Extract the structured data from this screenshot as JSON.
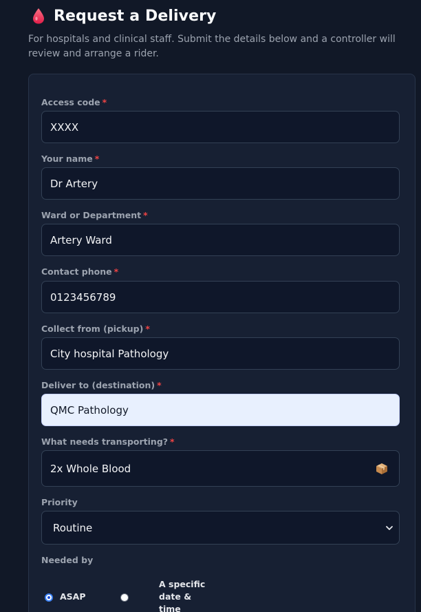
{
  "header": {
    "title": "Request a Delivery",
    "subtitle": "For hospitals and clinical staff. Submit the details below and a controller will review and arrange a rider."
  },
  "form": {
    "required_marker": "*",
    "access_code": {
      "label": "Access code",
      "value": "XXXX"
    },
    "your_name": {
      "label": "Your name",
      "value": "Dr Artery"
    },
    "ward": {
      "label": "Ward or Department",
      "value": "Artery Ward"
    },
    "contact_phone": {
      "label": "Contact phone",
      "value": "0123456789"
    },
    "collect_from": {
      "label": "Collect from (pickup)",
      "value": "City hospital Pathology"
    },
    "deliver_to": {
      "label": "Deliver to (destination)",
      "value": "QMC Pathology"
    },
    "transport_item": {
      "label": "What needs transporting?",
      "value": "2x Whole Blood",
      "icon": "package-icon"
    },
    "priority": {
      "label": "Priority",
      "selected": "Routine"
    },
    "needed_by": {
      "label": "Needed by",
      "options": [
        {
          "label": "ASAP",
          "checked": true
        },
        {
          "label_lines": [
            "A specific",
            "date &",
            "time"
          ],
          "checked": false
        }
      ]
    }
  },
  "colors": {
    "background": "#111827",
    "card": "#172033",
    "accent": "#3b82f6",
    "required": "#ef4444",
    "brand_drop": "#f43f5e"
  }
}
